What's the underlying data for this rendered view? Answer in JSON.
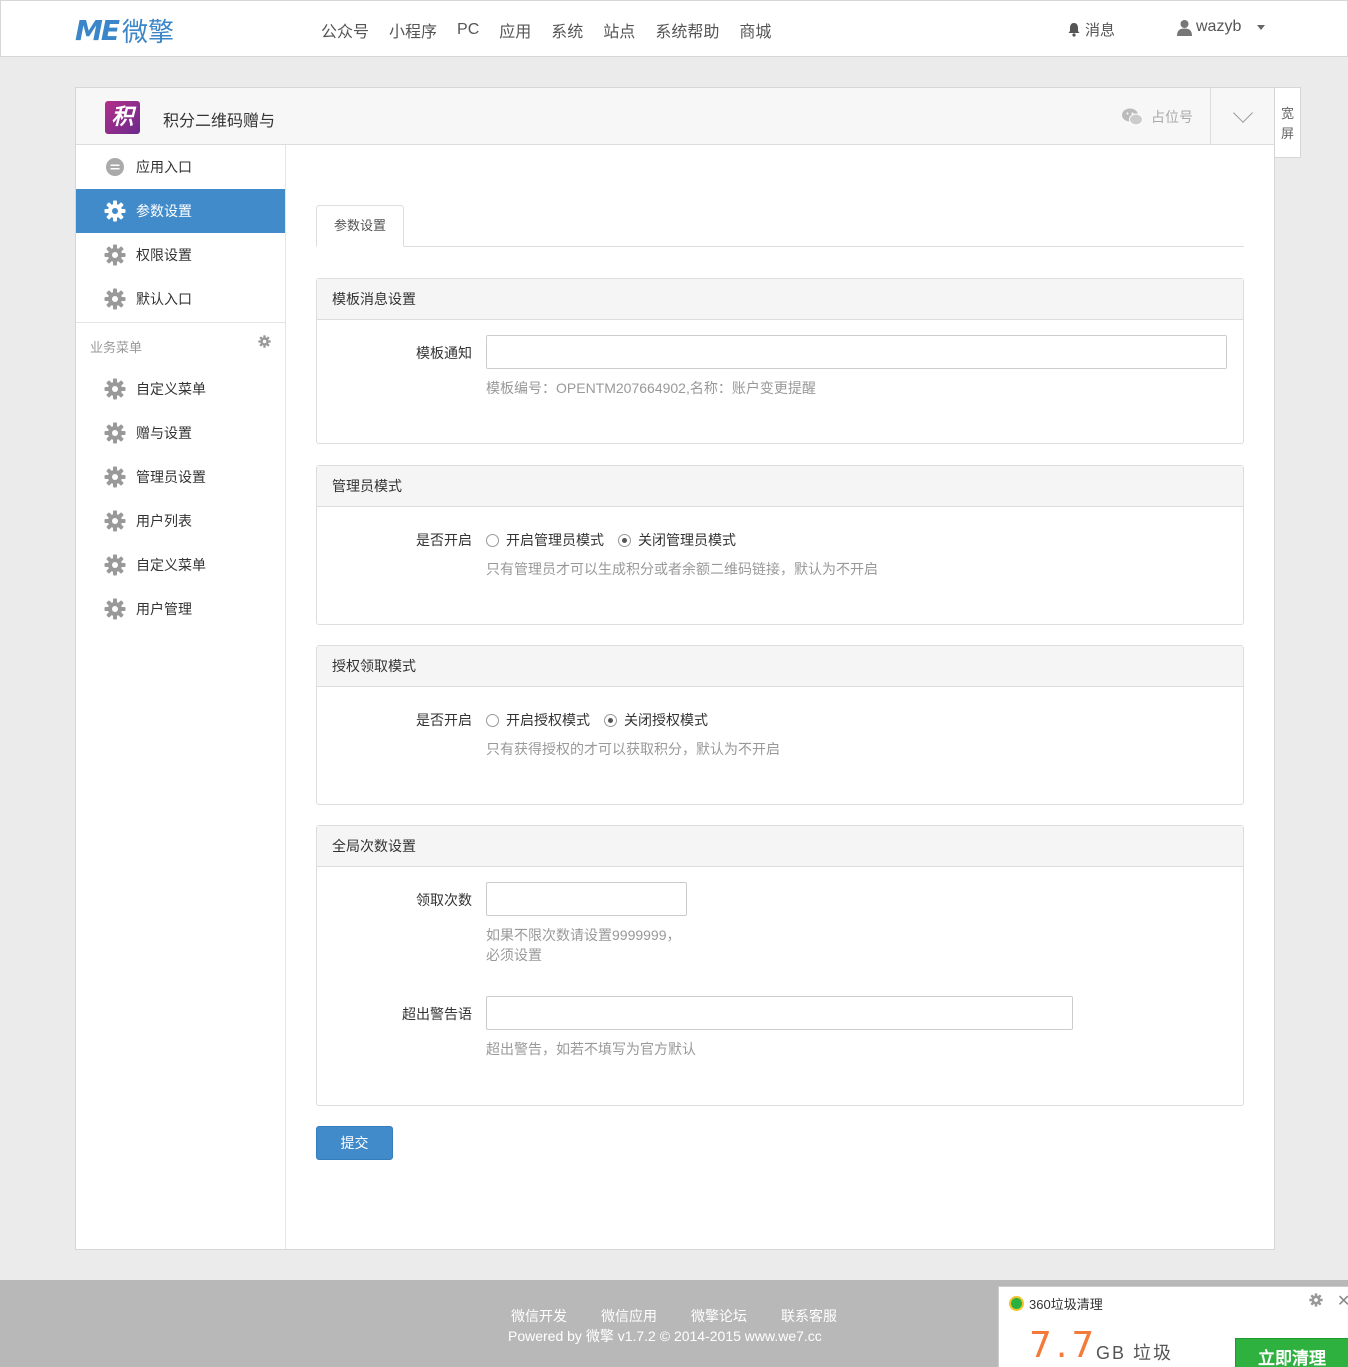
{
  "brand": {
    "logo_mark": "ME",
    "logo_text": "微擎"
  },
  "nav": [
    "公众号",
    "小程序",
    "PC",
    "应用",
    "系统",
    "站点",
    "系统帮助",
    "商城"
  ],
  "header_right": {
    "messages": "消息",
    "username": "wazyb"
  },
  "app": {
    "icon_char": "积",
    "title": "积分二维码赠与",
    "account_label": "占位号",
    "wide_label_1": "宽",
    "wide_label_2": "屏"
  },
  "sidebar": {
    "items": [
      {
        "label": "应用入口",
        "icon": "chat-icon"
      },
      {
        "label": "参数设置",
        "icon": "gear-icon",
        "active": true
      },
      {
        "label": "权限设置",
        "icon": "gear-icon"
      },
      {
        "label": "默认入口",
        "icon": "gear-icon"
      }
    ],
    "group_title": "业务菜单",
    "group_items": [
      "自定义菜单",
      "赠与设置",
      "管理员设置",
      "用户列表",
      "自定义菜单",
      "用户管理"
    ]
  },
  "tab": "参数设置",
  "panels": {
    "template": {
      "title": "模板消息设置",
      "label": "模板通知",
      "value": "",
      "help": "模板编号：OPENTM207664902,名称：账户变更提醒"
    },
    "admin": {
      "title": "管理员模式",
      "label": "是否开启",
      "opt_on": "开启管理员模式",
      "opt_off": "关闭管理员模式",
      "selected": "off",
      "help": "只有管理员才可以生成积分或者余额二维码链接，默认为不开启"
    },
    "auth": {
      "title": "授权领取模式",
      "label": "是否开启",
      "opt_on": "开启授权模式",
      "opt_off": "关闭授权模式",
      "selected": "off",
      "help": "只有获得授权的才可以获取积分，默认为不开启"
    },
    "global": {
      "title": "全局次数设置",
      "count_label": "领取次数",
      "count_value": "",
      "count_help_1": "如果不限次数请设置9999999，",
      "count_help_2": "必须设置",
      "warn_label": "超出警告语",
      "warn_value": "",
      "warn_help": "超出警告，如若不填写为官方默认"
    }
  },
  "submit": "提交",
  "footer": {
    "links": [
      "微信开发",
      "微信应用",
      "微擎论坛",
      "联系客服"
    ],
    "copyright": "Powered by 微擎 v1.7.2 © 2014-2015 www.we7.cc"
  },
  "popup": {
    "title": "360垃圾清理",
    "amount": "7.7",
    "unit": "GB 垃圾",
    "button": "立即清理"
  },
  "colors": {
    "primary": "#428bca",
    "footer": "#b8b8b8",
    "popup_accent": "#f47a3a",
    "popup_button": "#2fb13f"
  }
}
